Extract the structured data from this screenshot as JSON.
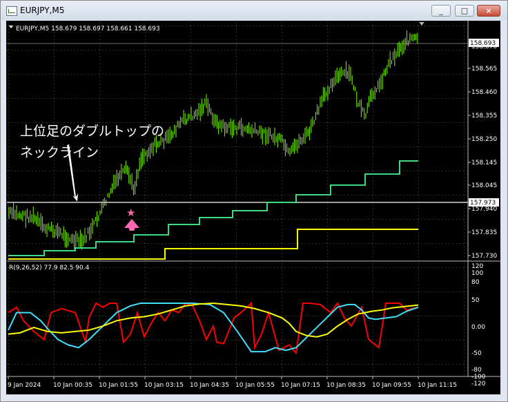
{
  "window": {
    "title": "EURJPY,M5",
    "minimize": "_",
    "maximize": "□",
    "close": "×"
  },
  "chart_header": "EURJPY,M5  158.679 158.697 158.661 158.693",
  "price_axis": {
    "labels": [
      "158.670",
      "158.565",
      "158.460",
      "158.355",
      "158.250",
      "158.145",
      "158.045",
      "157.940",
      "157.835",
      "157.730"
    ],
    "current_price": "158.693",
    "neckline_price": "157.973"
  },
  "oscillator": {
    "header": "R(9,26,52) 77.9 82.5 90.4",
    "labels": [
      "120",
      "100",
      "80",
      "50",
      "0.00",
      "-50",
      "-80",
      "-100",
      "-120"
    ]
  },
  "time_axis": [
    "9 Jan 2024",
    "10 Jan 00:35",
    "10 Jan 01:55",
    "10 Jan 03:15",
    "10 Jan 04:35",
    "10 Jan 05:55",
    "10 Jan 07:15",
    "10 Jan 08:35",
    "10 Jan 09:55",
    "10 Jan 11:15"
  ],
  "annotation": {
    "line1": "上位足のダブルトップの",
    "line2": "ネックライン"
  },
  "markers": {
    "star": "★"
  },
  "colors": {
    "candles": "#7cfc00",
    "green_line": "#3ddc84",
    "yellow_line": "#ffff00",
    "neckline": "#ffffff",
    "osc_red": "#ff0000",
    "osc_cyan": "#40e0ff",
    "osc_yellow": "#ffff00",
    "arrow": "#ff69b4"
  }
}
